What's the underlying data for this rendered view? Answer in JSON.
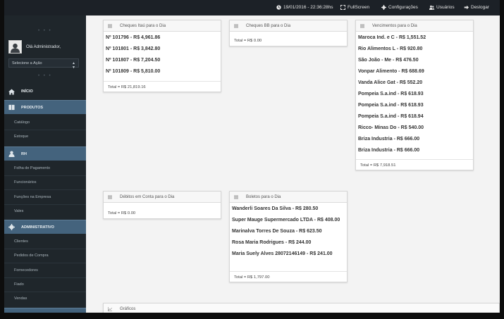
{
  "topbar": {
    "datetime": "19/01/2016 - 22:36:28hs",
    "fullscreen": "FullScreen",
    "settings": "Configurações",
    "users": "Usuários",
    "logout": "Deslogar"
  },
  "sidebar": {
    "greeting": "Olá Administrador,",
    "action_select": "Selecione a Ação",
    "sections": [
      {
        "label": "INÍCIO"
      },
      {
        "label": "PRODUTOS",
        "items": [
          "Catálogo",
          "Estoque"
        ]
      },
      {
        "label": "RH",
        "items": [
          "Folha de Pagamento",
          "Funcionários",
          "Funções na Empresa",
          "Vales"
        ]
      },
      {
        "label": "ADMINISTRATIVO",
        "items": [
          "Clientes",
          "Pedidos de Compra",
          "Fornecedores",
          "Fiado",
          "Vendas"
        ]
      }
    ]
  },
  "panels": {
    "cheques_itau": {
      "title": "Cheques Itaú para o Dia",
      "rows": [
        "Nº 101796 - R$ 4,961.86",
        "Nº 101801 - R$ 3,842.80",
        "Nº 101807 - R$ 7,204.50",
        "Nº 101809 - R$ 5,810.00"
      ],
      "total": "Total = R$ 21,819.16"
    },
    "cheques_bb": {
      "title": "Cheques BB para o Dia",
      "total": "Total = R$ 0.00"
    },
    "vencimentos": {
      "title": "Vencimentos para o Dia",
      "rows": [
        "Maroca Ind. e C - R$ 1,551.52",
        "Rio Alimentos L - R$ 920.80",
        "São João - Me - R$ 476.50",
        "Vonpar Alimento - R$ 688.69",
        "Vanda Alice Gat - R$ 552.20",
        "Pompeia S.a.ind - R$ 618.93",
        "Pompeia S.a.ind - R$ 618.93",
        "Pompeia S.a.ind - R$ 618.94",
        "Ricco- Minas Do - R$ 540.00",
        "Briza Industria - R$ 666.00",
        "Briza Industria - R$ 666.00"
      ],
      "total": "Total = R$ 7,918.51"
    },
    "debitos": {
      "title": "Débitos em Conta para o Dia",
      "total": "Total = R$ 0.00"
    },
    "boletos": {
      "title": "Boletos para o Dia",
      "rows": [
        "Wanderli Soares Da Silva - R$ 280.50",
        "Super Mauge Supermercado LTDA - R$ 408.00",
        "Marinalva Torres De Souza - R$ 623.50",
        "Rosa Maria Rodrigues - R$ 244.00",
        "Maria Suely Alves 28072146149 - R$ 241.00"
      ],
      "total": "Total = R$ 1,797.00"
    },
    "graficos": {
      "title": "Gráficos"
    }
  },
  "colors": {
    "topbar": "#1c2127",
    "sidebar": "#1f262b",
    "nav_highlight": "#44637d"
  }
}
